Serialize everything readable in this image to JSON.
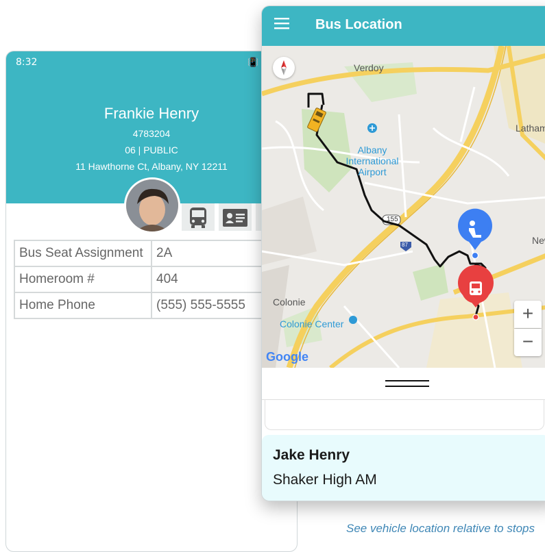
{
  "left_screen": {
    "status_time": "8:32",
    "student": {
      "name": "Frankie Henry",
      "id": "4783204",
      "grade": "06 | PUBLIC",
      "address": "11 Hawthorne Ct, Albany, NY 12211"
    },
    "info_rows": [
      {
        "label": "Bus Seat Assignment",
        "value": "2A"
      },
      {
        "label": "Homeroom #",
        "value": "404"
      },
      {
        "label": "Home Phone",
        "value": "(555) 555-5555"
      }
    ],
    "tab_icons": [
      "bus-icon",
      "contact-card-icon"
    ]
  },
  "right_screen": {
    "title": "Bus Location",
    "map_labels": {
      "verdoy": "Verdoy",
      "latham": "Latham",
      "airport": "Albany International Airport",
      "colonie": "Colonie",
      "colonie_center": "Colonie Center",
      "new": "New",
      "route_155": "155",
      "route_87": "87"
    },
    "google": "Google",
    "zoom_in": "+",
    "zoom_out": "−",
    "rider": {
      "name": "Jake Henry",
      "route": "Shaker High AM"
    }
  },
  "caption": "See vehicle location relative to stops",
  "colors": {
    "accent": "#3db6c3",
    "stop_blue": "#3d7ff2",
    "stop_red": "#e84040",
    "bus_yellow": "#f2b322",
    "route": "#111111",
    "highway": "#f5d05e"
  }
}
